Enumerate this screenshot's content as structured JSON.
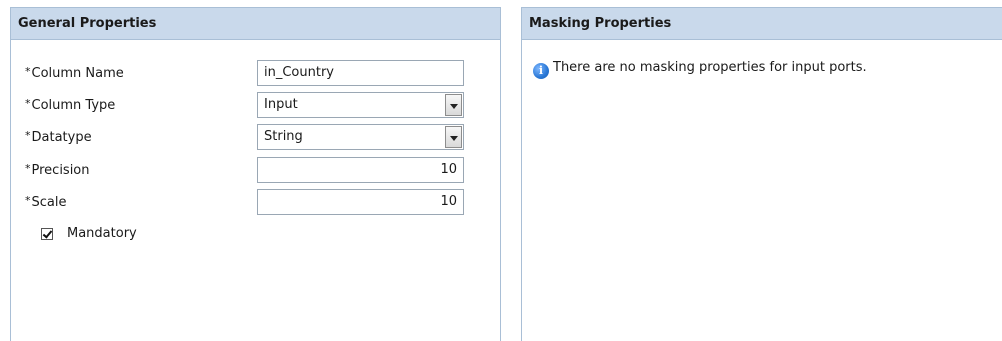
{
  "general": {
    "title": "General Properties",
    "required_mark": "*",
    "fields": [
      {
        "label": "Column Name",
        "value": "in_Country",
        "kind": "text"
      },
      {
        "label": "Column Type",
        "value": "Input",
        "kind": "select"
      },
      {
        "label": "Datatype",
        "value": "String",
        "kind": "select"
      },
      {
        "label": "Precision",
        "value": "10",
        "kind": "number"
      },
      {
        "label": "Scale",
        "value": "10",
        "kind": "number"
      }
    ],
    "mandatory": {
      "label": "Mandatory",
      "checked": true
    }
  },
  "masking": {
    "title": "Masking Properties",
    "info_icon": "info-icon",
    "message": "There are no masking properties for input ports."
  }
}
